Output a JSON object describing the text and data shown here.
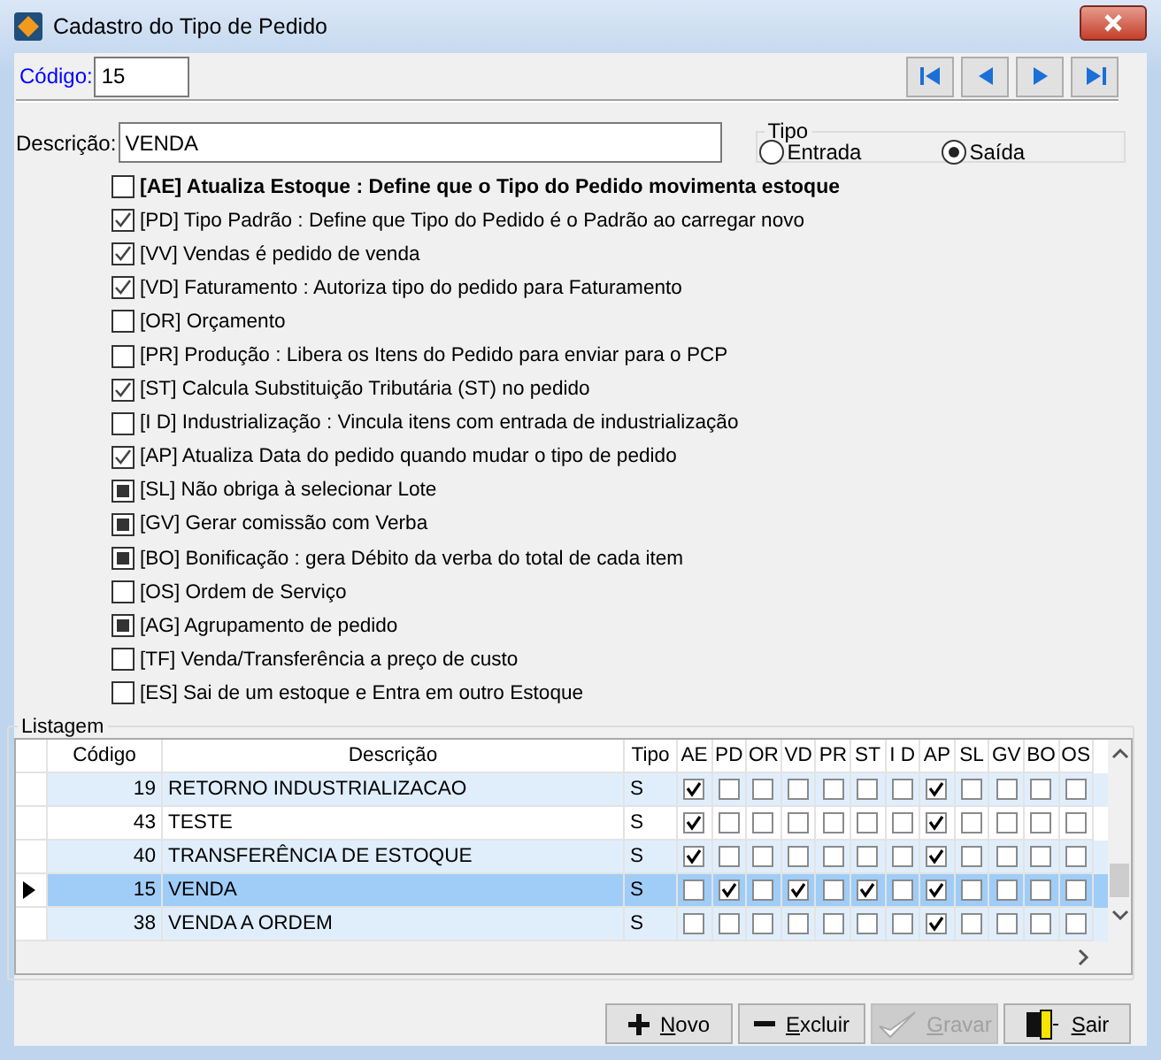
{
  "window": {
    "title": "Cadastro do Tipo de Pedido"
  },
  "codigo": {
    "label": "Código:",
    "value": "15"
  },
  "nav_buttons": [
    {
      "kind": "first"
    },
    {
      "kind": "prev"
    },
    {
      "kind": "next"
    },
    {
      "kind": "last"
    }
  ],
  "descricao": {
    "label": "Descrição:",
    "value": "VENDA"
  },
  "tipo": {
    "title": "Tipo",
    "options": [
      {
        "label": "Entrada",
        "selected": false
      },
      {
        "label": "Saída",
        "selected": true
      }
    ]
  },
  "options": [
    {
      "label": "[AE] Atualiza Estoque :  Define que o Tipo do Pedido movimenta estoque",
      "checked": false,
      "indeterminate": false,
      "bold": true
    },
    {
      "label": "[PD] Tipo Padrão :  Define que Tipo do Pedido é o Padrão ao carregar novo",
      "checked": true,
      "indeterminate": false,
      "bold": false
    },
    {
      "label": "[VV] Vendas é pedido de venda",
      "checked": true,
      "indeterminate": false,
      "bold": false
    },
    {
      "label": "[VD] Faturamento :  Autoriza tipo do pedido para Faturamento",
      "checked": true,
      "indeterminate": false,
      "bold": false
    },
    {
      "label": "[OR] Orçamento",
      "checked": false,
      "indeterminate": false,
      "bold": false
    },
    {
      "label": "[PR] Produção :  Libera os Itens do Pedido para enviar para o PCP",
      "checked": false,
      "indeterminate": false,
      "bold": false
    },
    {
      "label": "[ST] Calcula Substituição Tributária (ST) no pedido",
      "checked": true,
      "indeterminate": false,
      "bold": false
    },
    {
      "label": "[I D] Industrialização : Vincula itens com entrada de industrialização",
      "checked": false,
      "indeterminate": false,
      "bold": false
    },
    {
      "label": "[AP] Atualiza Data do pedido quando mudar o tipo de pedido",
      "checked": true,
      "indeterminate": false,
      "bold": false
    },
    {
      "label": "[SL] Não obriga à selecionar Lote",
      "checked": false,
      "indeterminate": true,
      "bold": false
    },
    {
      "label": "[GV] Gerar comissão com Verba",
      "checked": false,
      "indeterminate": true,
      "bold": false
    },
    {
      "label": "[BO] Bonificação : gera Débito da verba do total de cada item",
      "checked": false,
      "indeterminate": true,
      "bold": false
    },
    {
      "label": "[OS] Ordem de Serviço",
      "checked": false,
      "indeterminate": false,
      "bold": false
    },
    {
      "label": "[AG] Agrupamento de pedido",
      "checked": false,
      "indeterminate": true,
      "bold": false
    },
    {
      "label": "[TF] Venda/Transferência a preço de custo",
      "checked": false,
      "indeterminate": false,
      "bold": false
    },
    {
      "label": "[ES] Sai de um estoque e Entra em outro Estoque",
      "checked": false,
      "indeterminate": false,
      "bold": false
    }
  ],
  "listagem": {
    "title": "Listagem",
    "columns": [
      "Código",
      "Descrição",
      "Tipo",
      "AE",
      "PD",
      "OR",
      "VD",
      "PR",
      "ST",
      "I D",
      "AP",
      "SL",
      "GV",
      "BO",
      "OS"
    ],
    "rows": [
      {
        "codigo": "19",
        "descricao": "RETORNO INDUSTRIALIZACAO",
        "tipo": "S",
        "selected": false,
        "checks": [
          true,
          false,
          false,
          false,
          false,
          false,
          false,
          true,
          false,
          false,
          false,
          false
        ]
      },
      {
        "codigo": "43",
        "descricao": "TESTE",
        "tipo": "S",
        "selected": false,
        "checks": [
          true,
          false,
          false,
          false,
          false,
          false,
          false,
          true,
          false,
          false,
          false,
          false
        ]
      },
      {
        "codigo": "40",
        "descricao": "TRANSFERÊNCIA DE ESTOQUE",
        "tipo": "S",
        "selected": false,
        "checks": [
          true,
          false,
          false,
          false,
          false,
          false,
          false,
          true,
          false,
          false,
          false,
          false
        ]
      },
      {
        "codigo": "15",
        "descricao": "VENDA",
        "tipo": "S",
        "selected": true,
        "checks": [
          false,
          true,
          false,
          true,
          false,
          true,
          false,
          true,
          false,
          false,
          false,
          false
        ]
      },
      {
        "codigo": "38",
        "descricao": "VENDA A ORDEM",
        "tipo": "S",
        "selected": false,
        "checks": [
          false,
          false,
          false,
          false,
          false,
          false,
          false,
          true,
          false,
          false,
          false,
          false
        ]
      }
    ]
  },
  "buttons": [
    {
      "label": "Novo",
      "kind": "add",
      "disabled": false
    },
    {
      "label": "Excluir",
      "kind": "delete",
      "disabled": false
    },
    {
      "label": "Gravar",
      "kind": "save",
      "disabled": true
    },
    {
      "label": "Sair",
      "kind": "exit",
      "disabled": false
    }
  ]
}
